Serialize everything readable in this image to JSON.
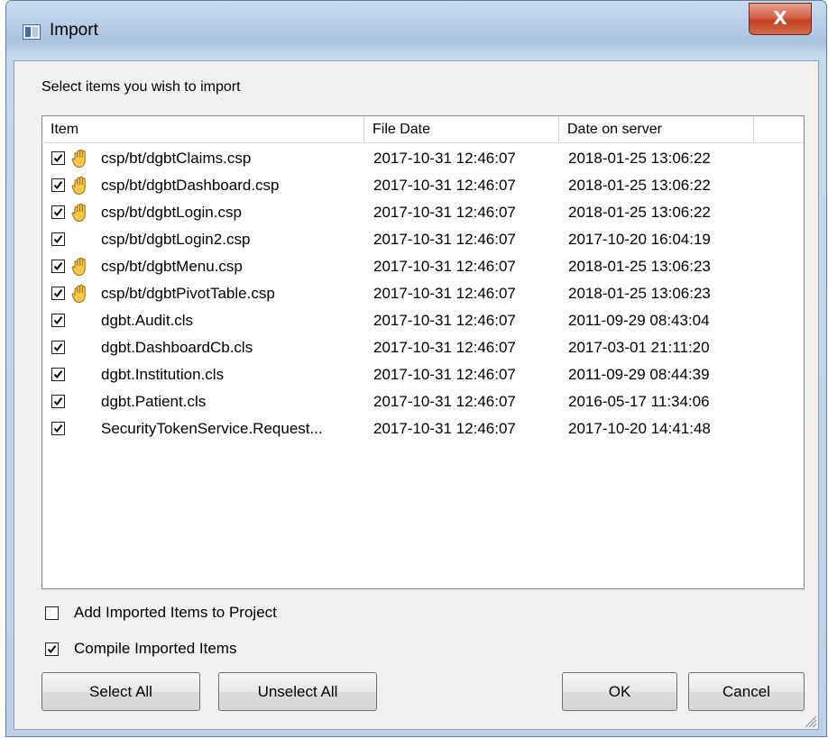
{
  "window": {
    "title": "Import",
    "close_label": "X"
  },
  "prompt": "Select items you wish to import",
  "list": {
    "columns": [
      "Item",
      "File Date",
      "Date on server"
    ],
    "rows": [
      {
        "checked": true,
        "locked": true,
        "item": "csp/bt/dgbtClaims.csp",
        "file_date": "2017-10-31 12:46:07",
        "server_date": "2018-01-25 13:06:22"
      },
      {
        "checked": true,
        "locked": true,
        "item": "csp/bt/dgbtDashboard.csp",
        "file_date": "2017-10-31 12:46:07",
        "server_date": "2018-01-25 13:06:22"
      },
      {
        "checked": true,
        "locked": true,
        "item": "csp/bt/dgbtLogin.csp",
        "file_date": "2017-10-31 12:46:07",
        "server_date": "2018-01-25 13:06:22"
      },
      {
        "checked": true,
        "locked": false,
        "item": "csp/bt/dgbtLogin2.csp",
        "file_date": "2017-10-31 12:46:07",
        "server_date": "2017-10-20 16:04:19"
      },
      {
        "checked": true,
        "locked": true,
        "item": "csp/bt/dgbtMenu.csp",
        "file_date": "2017-10-31 12:46:07",
        "server_date": "2018-01-25 13:06:23"
      },
      {
        "checked": true,
        "locked": true,
        "item": "csp/bt/dgbtPivotTable.csp",
        "file_date": "2017-10-31 12:46:07",
        "server_date": "2018-01-25 13:06:23"
      },
      {
        "checked": true,
        "locked": false,
        "item": "dgbt.Audit.cls",
        "file_date": "2017-10-31 12:46:07",
        "server_date": "2011-09-29 08:43:04"
      },
      {
        "checked": true,
        "locked": false,
        "item": "dgbt.DashboardCb.cls",
        "file_date": "2017-10-31 12:46:07",
        "server_date": "2017-03-01 21:11:20"
      },
      {
        "checked": true,
        "locked": false,
        "item": "dgbt.Institution.cls",
        "file_date": "2017-10-31 12:46:07",
        "server_date": "2011-09-29 08:44:39"
      },
      {
        "checked": true,
        "locked": false,
        "item": "dgbt.Patient.cls",
        "file_date": "2017-10-31 12:46:07",
        "server_date": "2016-05-17 11:34:06"
      },
      {
        "checked": true,
        "locked": false,
        "item": "SecurityTokenService.Request...",
        "file_date": "2017-10-31 12:46:07",
        "server_date": "2017-10-20 14:41:48"
      }
    ]
  },
  "options": {
    "add_to_project": {
      "label": "Add Imported Items to Project",
      "checked": false
    },
    "compile": {
      "label": "Compile Imported Items",
      "checked": true
    }
  },
  "buttons": {
    "select_all": "Select All",
    "unselect_all": "Unselect All",
    "ok": "OK",
    "cancel": "Cancel"
  },
  "icons": {
    "app": "import-window-icon",
    "lock": "hand-icon",
    "close": "close-icon"
  },
  "colors": {
    "titlebar": "#b9d1ea",
    "close_button": "#c3401f",
    "client_bg": "#f0f0f0",
    "list_bg": "#ffffff"
  }
}
